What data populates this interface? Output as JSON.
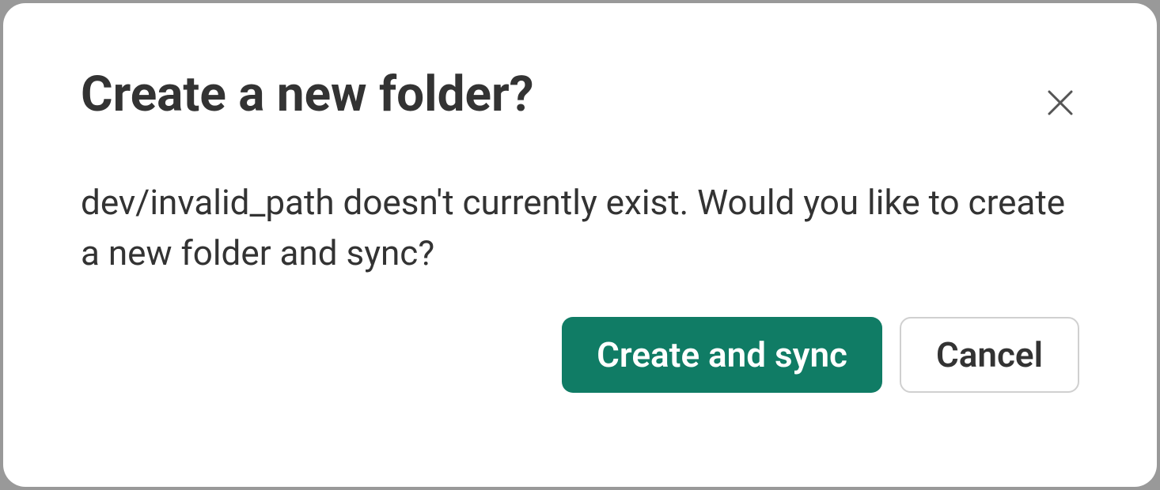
{
  "dialog": {
    "title": "Create a new folder?",
    "body": "dev/invalid_path doesn't currently exist. Would you like to create a new folder and sync?",
    "primary_button_label": "Create and sync",
    "secondary_button_label": "Cancel"
  }
}
